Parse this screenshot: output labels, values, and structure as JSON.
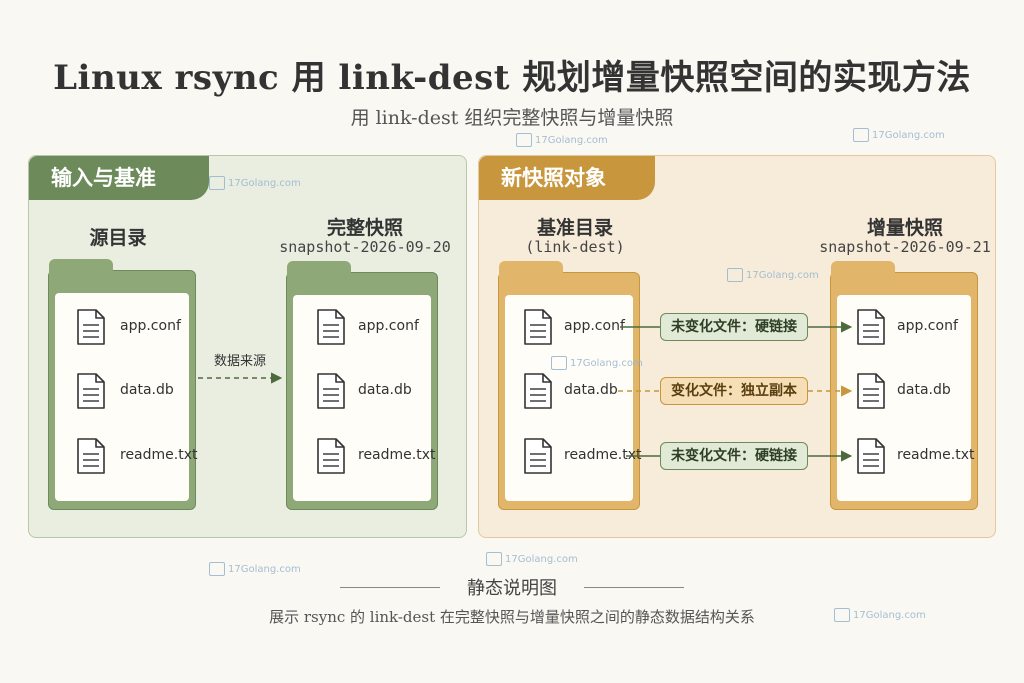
{
  "title": "Linux rsync 用 link-dest 规划增量快照空间的实现方法",
  "subtitle": "用 link-dest 组织完整快照与增量快照",
  "left_panel": {
    "tag": "输入与基准",
    "source": {
      "heading": "源目录"
    },
    "full_snapshot": {
      "heading": "完整快照",
      "subheading": "snapshot-2026-09-20"
    },
    "arrow_label": "数据来源"
  },
  "right_panel": {
    "tag": "新快照对象",
    "base": {
      "heading": "基准目录",
      "subheading": "(link-dest)"
    },
    "incremental": {
      "heading": "增量快照",
      "subheading": "snapshot-2026-09-21"
    }
  },
  "files": [
    "app.conf",
    "data.db",
    "readme.txt"
  ],
  "relations": [
    {
      "label": "未变化文件：硬链接",
      "kind": "unchanged"
    },
    {
      "label": "变化文件：独立副本",
      "kind": "changed"
    },
    {
      "label": "未变化文件：硬链接",
      "kind": "unchanged"
    }
  ],
  "footer": {
    "title": "静态说明图",
    "description": "展示 rsync 的 link-dest 在完整快照与增量快照之间的静态数据结构关系"
  },
  "watermark": {
    "text": "17Golang.com"
  },
  "colors": {
    "green": "#6c8a5a",
    "gold": "#c7963d",
    "green_bg": "#e9eee1",
    "gold_bg": "#f7ecda"
  },
  "icons": [
    "file-icon",
    "folder-icon",
    "arrow-right-icon"
  ]
}
